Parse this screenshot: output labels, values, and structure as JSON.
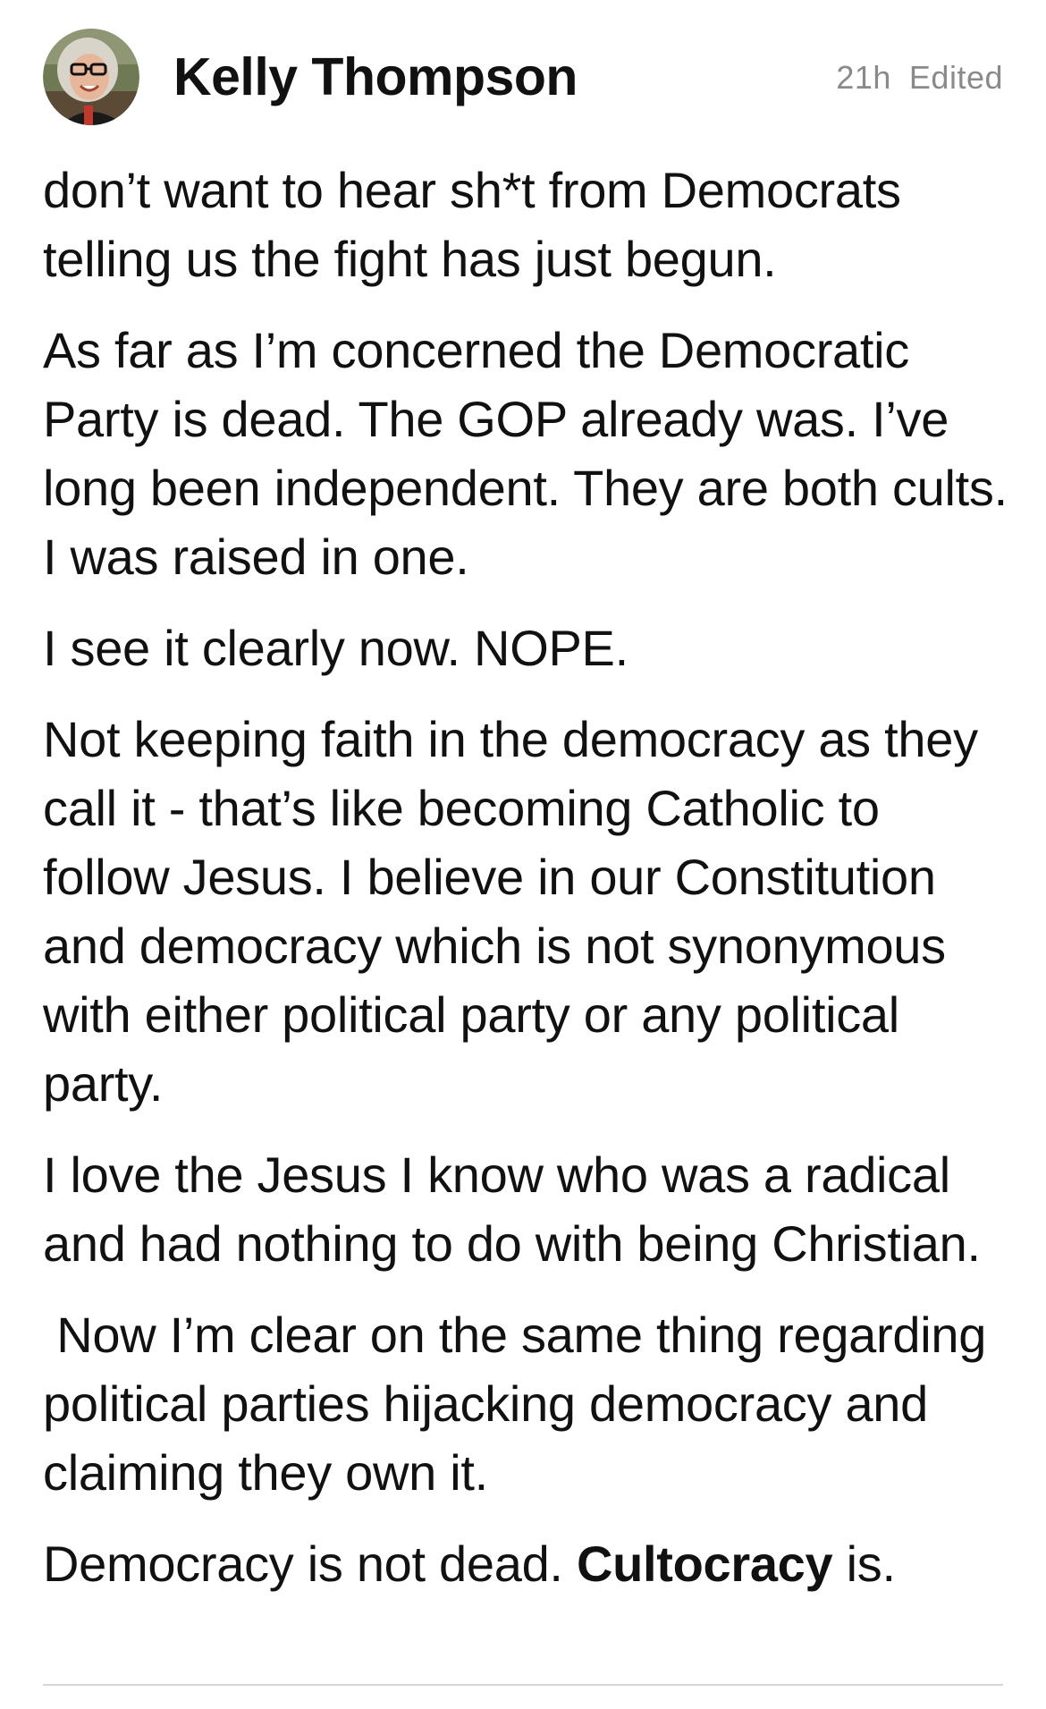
{
  "post": {
    "author": "Kelly Thompson",
    "time": "21h",
    "edited_label": "Edited",
    "paragraphs": [
      "don’t want to hear sh*t from Democrats telling us the fight has just begun.",
      "As far as I’m concerned the Democratic Party is dead. The GOP already was. I’ve long been independent. They are both cults. I was raised in one.",
      "I see it clearly now. NOPE.",
      "Not keeping faith in the democracy as they call it - that’s like becoming Catholic to follow Jesus. I believe in our Constitution and democracy which is not synonymous with either political party or any political party.",
      "I love the Jesus I know who was a radical and had nothing to do with being Christian.",
      " Now I’m clear on the same thing regarding political parties hijacking democracy and claiming they own it."
    ],
    "last_paragraph": {
      "before": "Democracy is not dead. ",
      "bold": "Cultocracy",
      "after": " is."
    }
  }
}
